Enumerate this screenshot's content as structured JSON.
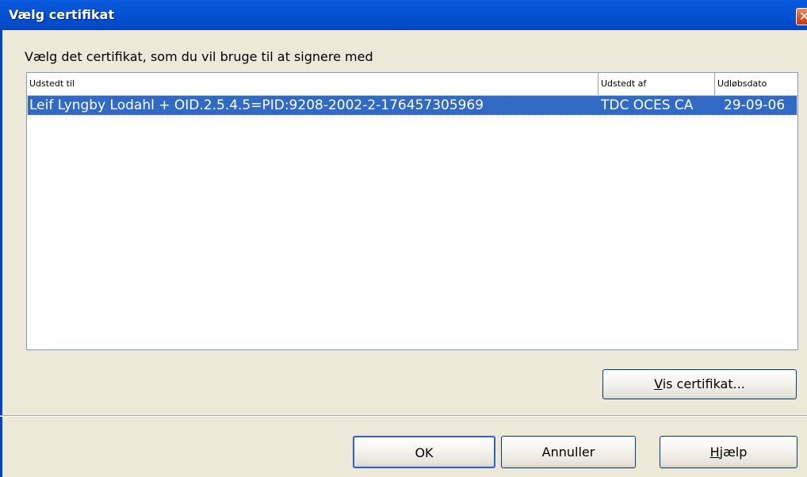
{
  "window": {
    "title": "Vælg certifikat"
  },
  "prompt": "Vælg det certifikat, som du vil bruge til at signere med",
  "table": {
    "columns": [
      "Udstedt til",
      "Udstedt af",
      "Udløbsdato"
    ],
    "rows": [
      {
        "issued_to": "Leif Lyngby Lodahl + OID.2.5.4.5=PID:9208-2002-2-176457305969",
        "issued_by": "TDC OCES CA",
        "expires": "29-09-06"
      }
    ]
  },
  "buttons": {
    "view_certificate_key": "V",
    "view_certificate_rest": "is certifikat...",
    "ok": "OK",
    "cancel": "Annuller",
    "help_key": "H",
    "help_rest": "jælp"
  },
  "colors": {
    "title_bar": "#0553d6",
    "selection": "#316ac5",
    "dialog_bg": "#ece9d8"
  },
  "icons": {
    "close": "close-icon"
  }
}
